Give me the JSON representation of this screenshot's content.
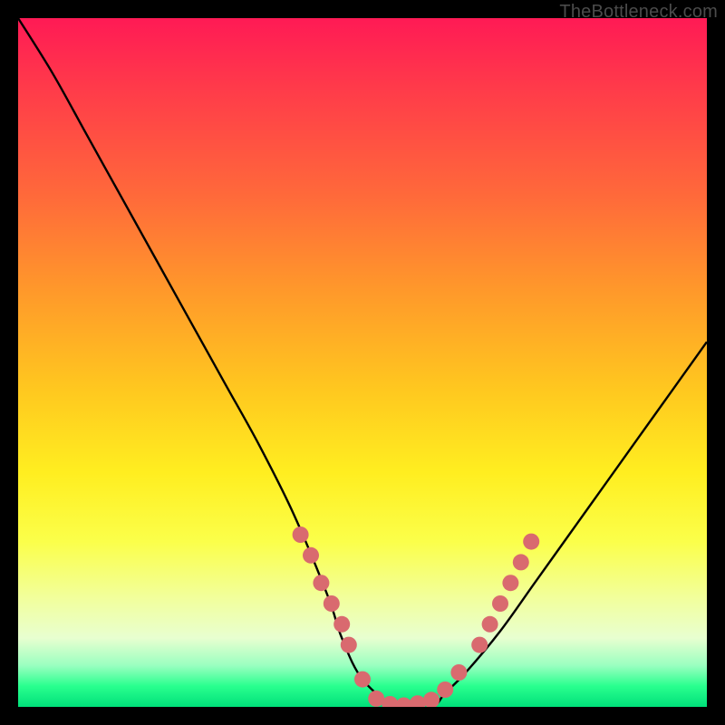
{
  "watermark": {
    "text": "TheBottleneck.com"
  },
  "colors": {
    "curve": "#000000",
    "dots": "#d96a6f",
    "gradient_top": "#ff1a55",
    "gradient_bottom": "#00e07a"
  },
  "chart_data": {
    "type": "line",
    "title": "",
    "xlabel": "",
    "ylabel": "",
    "xlim": [
      0,
      100
    ],
    "ylim": [
      0,
      100
    ],
    "grid": false,
    "legend": false,
    "series": [
      {
        "name": "bottleneck-curve",
        "x": [
          0,
          5,
          10,
          15,
          20,
          25,
          30,
          35,
          40,
          45,
          47,
          50,
          55,
          60,
          62,
          65,
          70,
          75,
          80,
          85,
          90,
          95,
          100
        ],
        "y": [
          100,
          92,
          83,
          74,
          65,
          56,
          47,
          38,
          28,
          16,
          10,
          4,
          0,
          0,
          2,
          5,
          11,
          18,
          25,
          32,
          39,
          46,
          53
        ]
      }
    ],
    "highlight_points": {
      "name": "optimal-range-dots",
      "color": "#d96a6f",
      "points": [
        {
          "x": 41,
          "y": 25
        },
        {
          "x": 42.5,
          "y": 22
        },
        {
          "x": 44,
          "y": 18
        },
        {
          "x": 45.5,
          "y": 15
        },
        {
          "x": 47,
          "y": 12
        },
        {
          "x": 48,
          "y": 9
        },
        {
          "x": 50,
          "y": 4
        },
        {
          "x": 52,
          "y": 1.2
        },
        {
          "x": 54,
          "y": 0.4
        },
        {
          "x": 56,
          "y": 0.2
        },
        {
          "x": 58,
          "y": 0.5
        },
        {
          "x": 60,
          "y": 1
        },
        {
          "x": 62,
          "y": 2.5
        },
        {
          "x": 64,
          "y": 5
        },
        {
          "x": 67,
          "y": 9
        },
        {
          "x": 68.5,
          "y": 12
        },
        {
          "x": 70,
          "y": 15
        },
        {
          "x": 71.5,
          "y": 18
        },
        {
          "x": 73,
          "y": 21
        },
        {
          "x": 74.5,
          "y": 24
        }
      ]
    }
  }
}
